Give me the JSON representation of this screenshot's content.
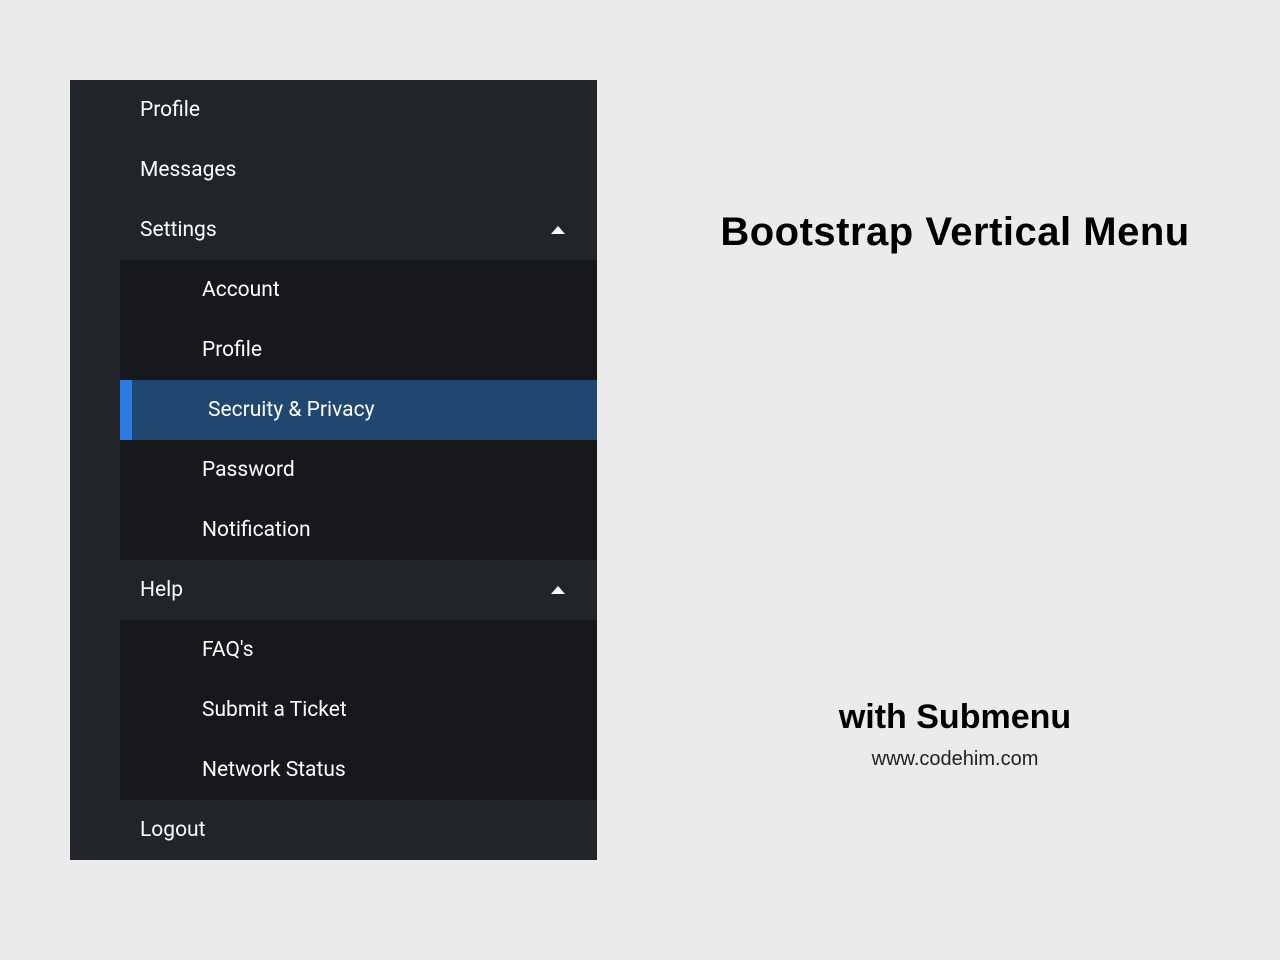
{
  "sidebar": {
    "items": [
      {
        "label": "Profile"
      },
      {
        "label": "Messages"
      },
      {
        "label": "Settings",
        "expanded": true,
        "submenu": [
          {
            "label": "Account"
          },
          {
            "label": "Profile"
          },
          {
            "label": "Secruity & Privacy",
            "active": true
          },
          {
            "label": "Password"
          },
          {
            "label": "Notification"
          }
        ]
      },
      {
        "label": "Help",
        "expanded": true,
        "submenu": [
          {
            "label": "FAQ's"
          },
          {
            "label": "Submit a Ticket"
          },
          {
            "label": "Network Status"
          }
        ]
      },
      {
        "label": "Logout"
      }
    ]
  },
  "right": {
    "title": "Bootstrap Vertical Menu",
    "subtitle": "with Submenu",
    "url": "www.codehim.com"
  }
}
